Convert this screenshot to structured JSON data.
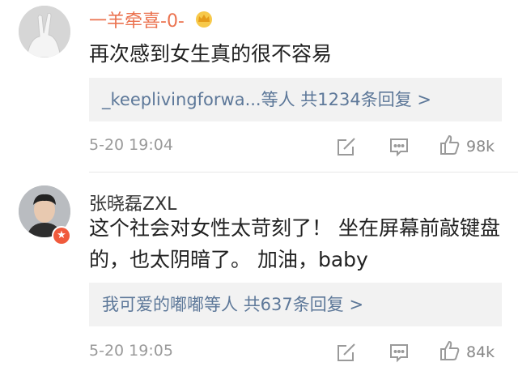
{
  "comments": [
    {
      "username": "一羊牵喜-0-",
      "text": "再次感到女生真的很不容易",
      "reply_users": "_keeplivingforwa...等人",
      "reply_count": "共1234条回复 >",
      "timestamp": "5-20 19:04",
      "likes": "98k"
    },
    {
      "username": "张晓磊ZXL",
      "text": "这个社会对女性太苛刻了！ 坐在屏幕前敲键盘的，也太阴暗了。 加油，baby",
      "reply_users": "我可爱的嘟嘟等人",
      "reply_count": "共637条回复 >",
      "timestamp": "5-20 19:05",
      "likes": "84k"
    }
  ],
  "colors": {
    "username_vip": "#eb7350",
    "reply_link": "#5d7899",
    "meta": "#9a9a9a",
    "badge": "#f05a3c"
  },
  "icons": [
    "crown-icon",
    "verified-badge-icon",
    "share-icon",
    "comment-icon",
    "like-icon"
  ]
}
